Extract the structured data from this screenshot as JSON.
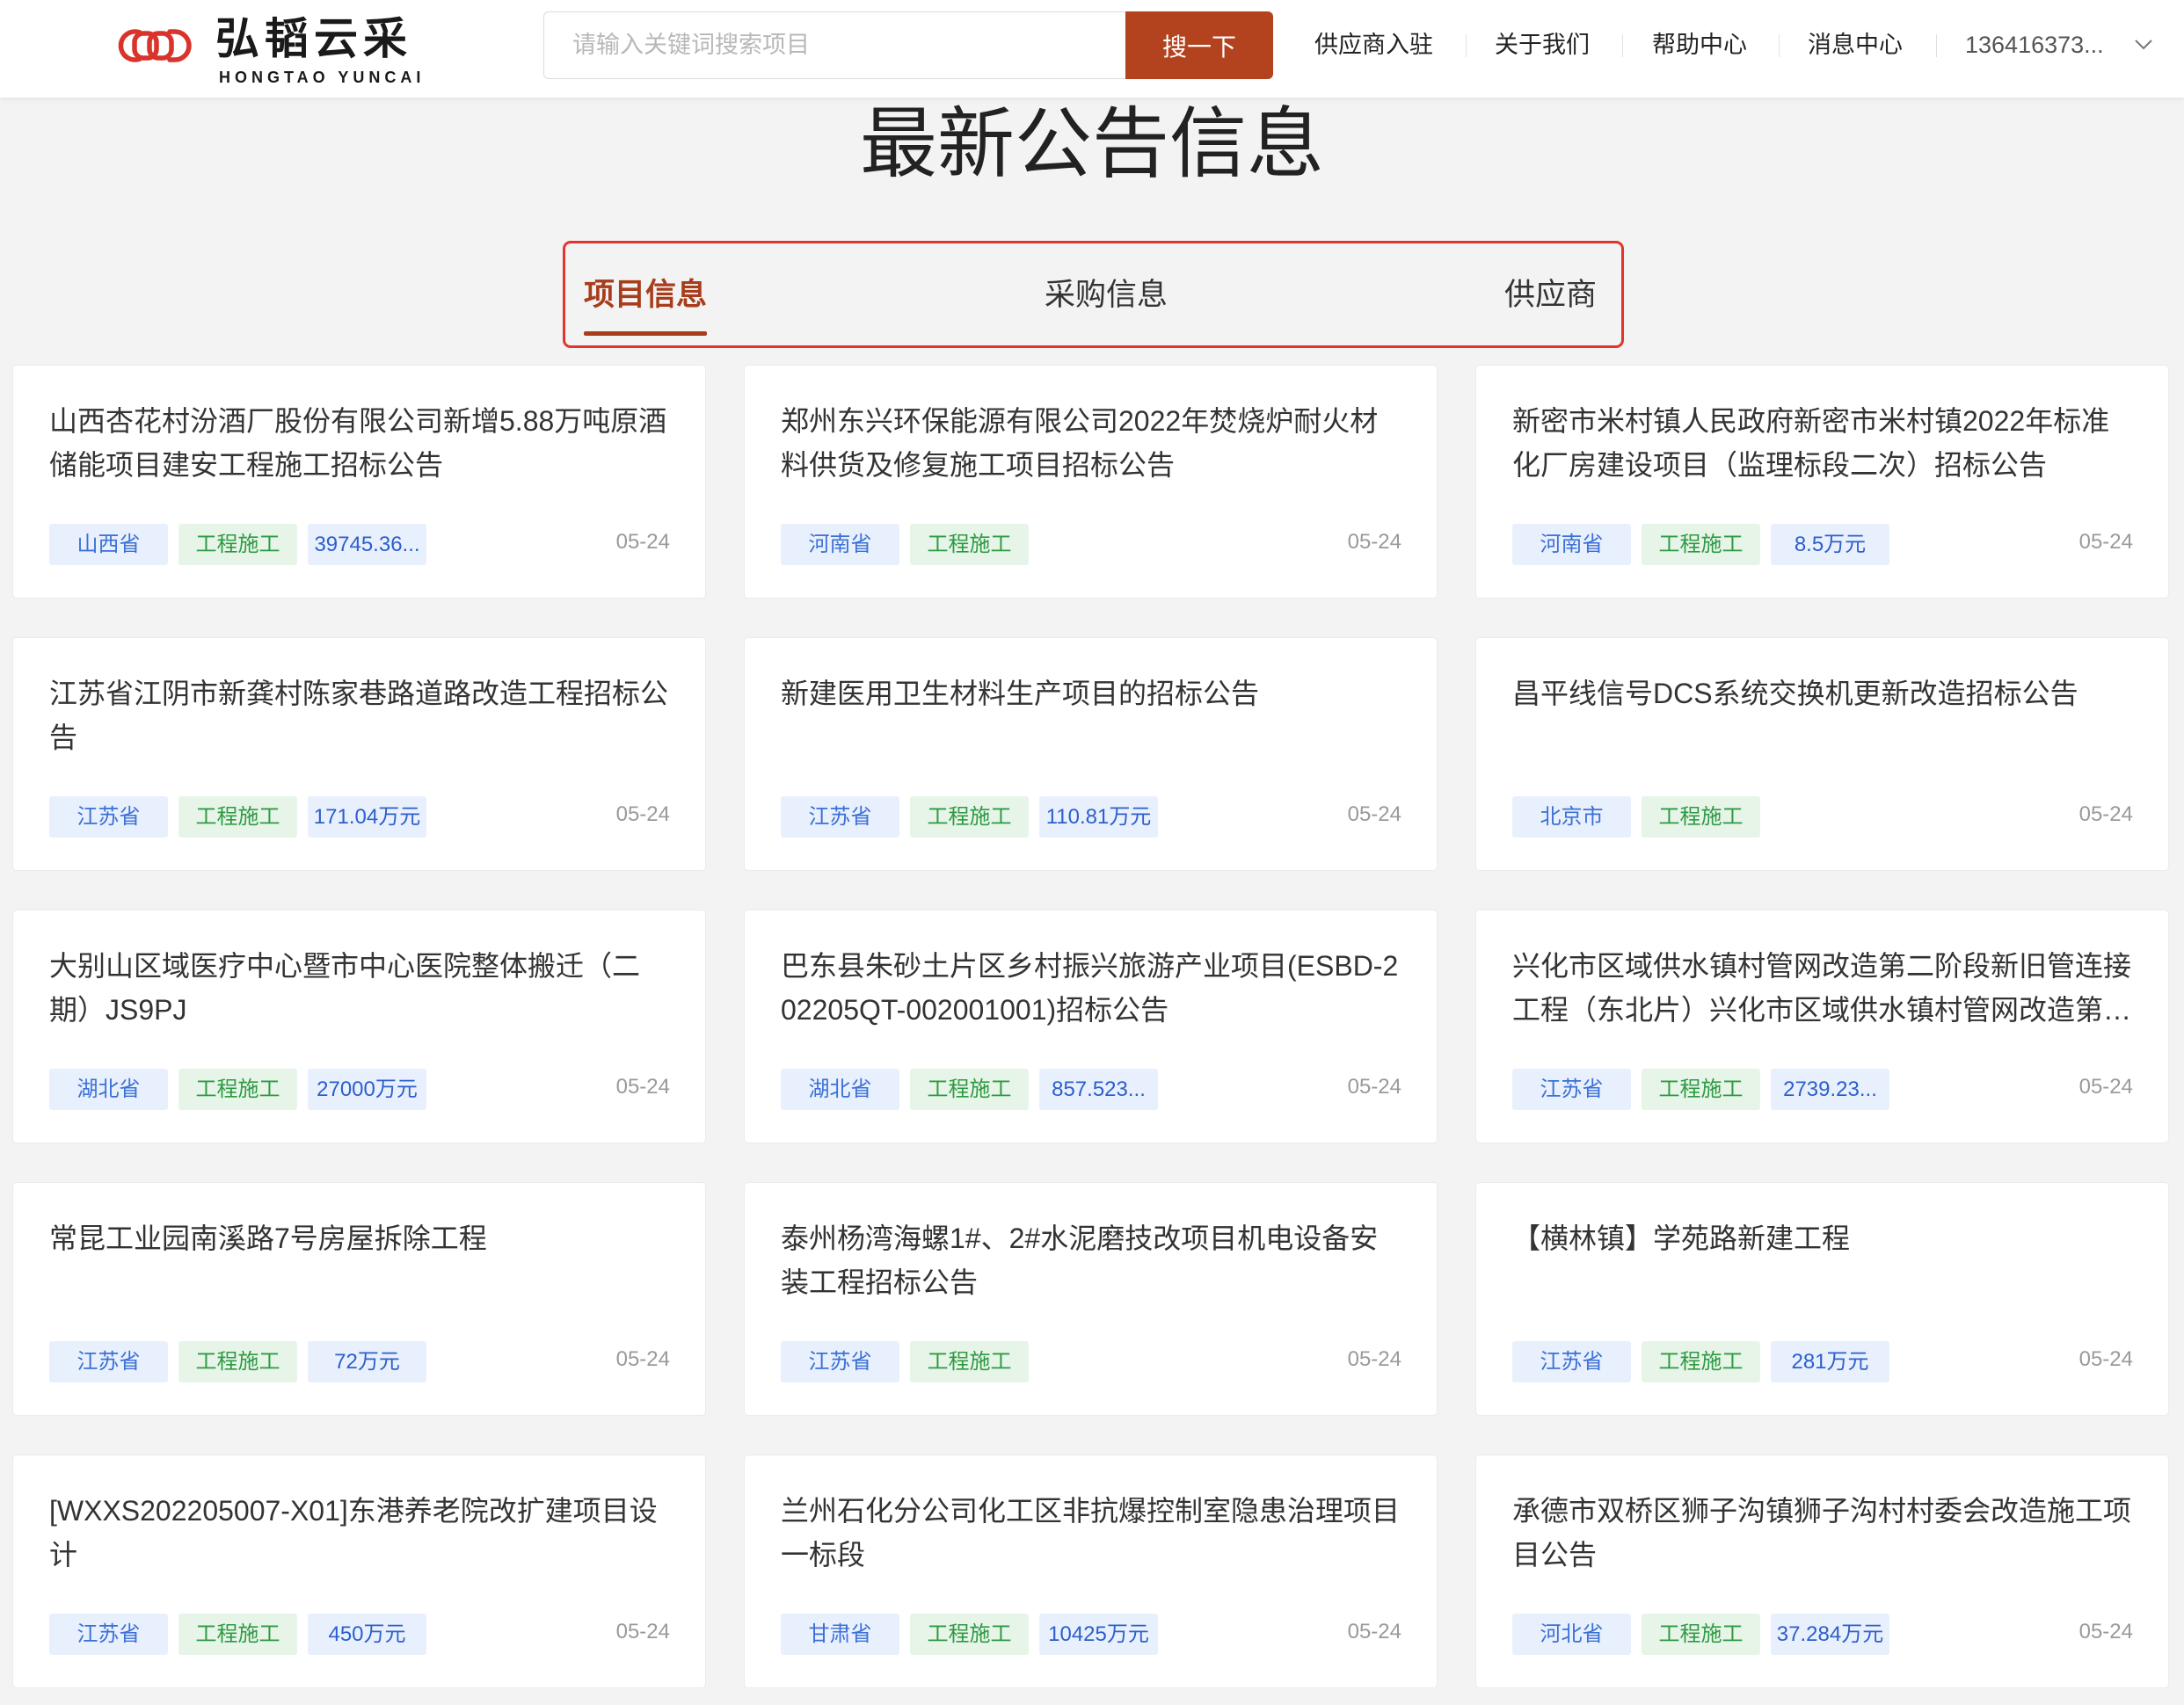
{
  "header": {
    "logo": {
      "name_cn": "弘韬云采",
      "name_en": "HONGTAO YUNCAI",
      "icon": "hongtao-logo-icon"
    },
    "search": {
      "placeholder": "请输入关键词搜索项目",
      "value": "",
      "button_label": "搜一下"
    },
    "nav": [
      {
        "label": "供应商入驻"
      },
      {
        "label": "关于我们"
      },
      {
        "label": "帮助中心"
      },
      {
        "label": "消息中心"
      }
    ],
    "user": {
      "label": "136416373...",
      "icon": "chevron-down-icon"
    }
  },
  "main": {
    "title": "最新公告信息",
    "tabs": [
      {
        "label": "项目信息",
        "active": true
      },
      {
        "label": "采购信息",
        "active": false
      },
      {
        "label": "供应商",
        "active": false
      }
    ],
    "cards": [
      {
        "title": "山西杏花村汾酒厂股份有限公司新增5.88万吨原酒储能项目建安工程施工招标公告",
        "tags": [
          {
            "text": "山西省",
            "kind": "region"
          },
          {
            "text": "工程施工",
            "kind": "category"
          },
          {
            "text": "39745.36...",
            "kind": "amount"
          }
        ],
        "date": "05-24"
      },
      {
        "title": "郑州东兴环保能源有限公司2022年焚烧炉耐火材料供货及修复施工项目招标公告",
        "tags": [
          {
            "text": "河南省",
            "kind": "region"
          },
          {
            "text": "工程施工",
            "kind": "category"
          }
        ],
        "date": "05-24"
      },
      {
        "title": "新密市米村镇人民政府新密市米村镇2022年标准化厂房建设项目（监理标段二次）招标公告",
        "tags": [
          {
            "text": "河南省",
            "kind": "region"
          },
          {
            "text": "工程施工",
            "kind": "category"
          },
          {
            "text": "8.5万元",
            "kind": "amount"
          }
        ],
        "date": "05-24"
      },
      {
        "title": "江苏省江阴市新龚村陈家巷路道路改造工程招标公告",
        "tags": [
          {
            "text": "江苏省",
            "kind": "region"
          },
          {
            "text": "工程施工",
            "kind": "category"
          },
          {
            "text": "171.04万元",
            "kind": "amount"
          }
        ],
        "date": "05-24"
      },
      {
        "title": "新建医用卫生材料生产项目的招标公告",
        "tags": [
          {
            "text": "江苏省",
            "kind": "region"
          },
          {
            "text": "工程施工",
            "kind": "category"
          },
          {
            "text": "110.81万元",
            "kind": "amount"
          }
        ],
        "date": "05-24"
      },
      {
        "title": "昌平线信号DCS系统交换机更新改造招标公告",
        "tags": [
          {
            "text": "北京市",
            "kind": "region"
          },
          {
            "text": "工程施工",
            "kind": "category"
          }
        ],
        "date": "05-24"
      },
      {
        "title": "大别山区域医疗中心暨市中心医院整体搬迁（二期）JS9PJ",
        "tags": [
          {
            "text": "湖北省",
            "kind": "region"
          },
          {
            "text": "工程施工",
            "kind": "category"
          },
          {
            "text": "27000万元",
            "kind": "amount"
          }
        ],
        "date": "05-24"
      },
      {
        "title": "巴东县朱砂土片区乡村振兴旅游产业项目(ESBD-202205QT-002001001)招标公告",
        "tags": [
          {
            "text": "湖北省",
            "kind": "region"
          },
          {
            "text": "工程施工",
            "kind": "category"
          },
          {
            "text": "857.523...",
            "kind": "amount"
          }
        ],
        "date": "05-24"
      },
      {
        "title": "兴化市区域供水镇村管网改造第二阶段新旧管连接工程（东北片）兴化市区域供水镇村管网改造第…",
        "tags": [
          {
            "text": "江苏省",
            "kind": "region"
          },
          {
            "text": "工程施工",
            "kind": "category"
          },
          {
            "text": "2739.23...",
            "kind": "amount"
          }
        ],
        "date": "05-24"
      },
      {
        "title": "常昆工业园南溪路7号房屋拆除工程",
        "tags": [
          {
            "text": "江苏省",
            "kind": "region"
          },
          {
            "text": "工程施工",
            "kind": "category"
          },
          {
            "text": "72万元",
            "kind": "amount"
          }
        ],
        "date": "05-24"
      },
      {
        "title": "泰州杨湾海螺1#、2#水泥磨技改项目机电设备安装工程招标公告",
        "tags": [
          {
            "text": "江苏省",
            "kind": "region"
          },
          {
            "text": "工程施工",
            "kind": "category"
          }
        ],
        "date": "05-24"
      },
      {
        "title": "【横林镇】学苑路新建工程",
        "tags": [
          {
            "text": "江苏省",
            "kind": "region"
          },
          {
            "text": "工程施工",
            "kind": "category"
          },
          {
            "text": "281万元",
            "kind": "amount"
          }
        ],
        "date": "05-24"
      },
      {
        "title": "[WXXS202205007-X01]东港养老院改扩建项目设计",
        "tags": [
          {
            "text": "江苏省",
            "kind": "region"
          },
          {
            "text": "工程施工",
            "kind": "category"
          },
          {
            "text": "450万元",
            "kind": "amount"
          }
        ],
        "date": "05-24"
      },
      {
        "title": "兰州石化分公司化工区非抗爆控制室隐患治理项目一标段",
        "tags": [
          {
            "text": "甘肃省",
            "kind": "region"
          },
          {
            "text": "工程施工",
            "kind": "category"
          },
          {
            "text": "10425万元",
            "kind": "amount"
          }
        ],
        "date": "05-24"
      },
      {
        "title": "承德市双桥区狮子沟镇狮子沟村村委会改造施工项目公告",
        "tags": [
          {
            "text": "河北省",
            "kind": "region"
          },
          {
            "text": "工程施工",
            "kind": "category"
          },
          {
            "text": "37.284万元",
            "kind": "amount"
          }
        ],
        "date": "05-24"
      }
    ]
  },
  "colors": {
    "accent": "#b3421f",
    "tab_border": "#e2342d",
    "logo": "#d9332b",
    "region_tag_text": "#3b70d6",
    "category_tag_text": "#2e9a44",
    "amount_tag_text": "#2c5fcc"
  }
}
